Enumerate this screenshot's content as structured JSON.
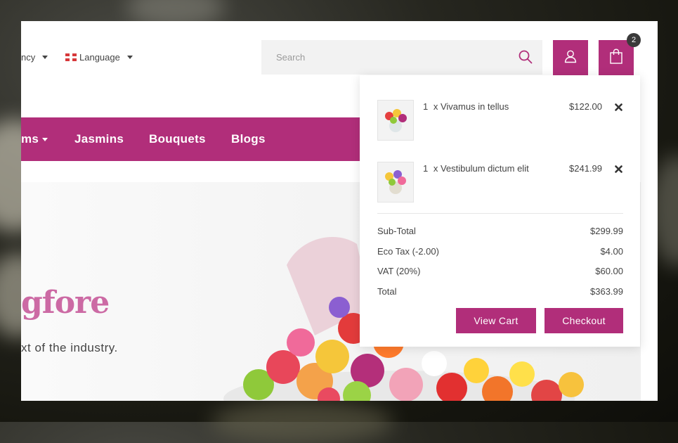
{
  "header": {
    "currency_label": "ncy",
    "language_label": "Language",
    "search_placeholder": "Search",
    "cart_count": "2"
  },
  "nav": {
    "items": [
      {
        "label": "ms"
      },
      {
        "label": "Jasmins"
      },
      {
        "label": "Bouquets"
      },
      {
        "label": "Blogs"
      }
    ]
  },
  "hero": {
    "title": "gfore",
    "text": "xt of the  industry."
  },
  "cart": {
    "items": [
      {
        "qty": "1",
        "name": "x Vivamus in tellus",
        "price": "$122.00"
      },
      {
        "qty": "1",
        "name": "x Vestibulum dictum elit",
        "price": "$241.99"
      }
    ],
    "totals": [
      {
        "label": "Sub-Total",
        "value": "$299.99"
      },
      {
        "label": "Eco Tax (-2.00)",
        "value": "$4.00"
      },
      {
        "label": "VAT (20%)",
        "value": "$60.00"
      },
      {
        "label": "Total",
        "value": "$363.99"
      }
    ],
    "view_cart_label": "View Cart",
    "checkout_label": "Checkout"
  },
  "colors": {
    "accent": "#b12e7a",
    "hero_title": "#cc6aa4",
    "badge": "#3a3a3a"
  },
  "icons": [
    "caret-down-icon",
    "flag-uk-icon",
    "search-icon",
    "user-icon",
    "shopping-bag-icon",
    "remove-icon"
  ]
}
